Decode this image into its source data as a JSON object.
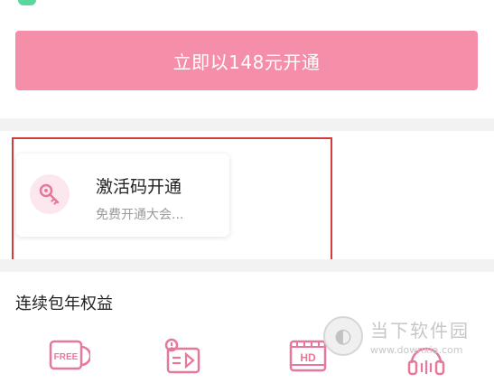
{
  "cta": {
    "label": "立即以148元开通"
  },
  "activation_card": {
    "title": "激活码开通",
    "subtitle": "免费开通大会..."
  },
  "benefits": {
    "title": "连续包年权益",
    "items": [
      {
        "icon": "free-icon",
        "text": "FREE"
      },
      {
        "icon": "video-privilege-icon"
      },
      {
        "icon": "hd-icon",
        "text": "HD"
      },
      {
        "icon": "audio-quality-icon"
      }
    ]
  },
  "watermark": {
    "name": "当下软件园",
    "url": "www.downxia.com"
  },
  "colors": {
    "accent_pink": "#f58fa9",
    "highlight_red": "#d43b3b",
    "icon_pink": "#e8789a"
  }
}
